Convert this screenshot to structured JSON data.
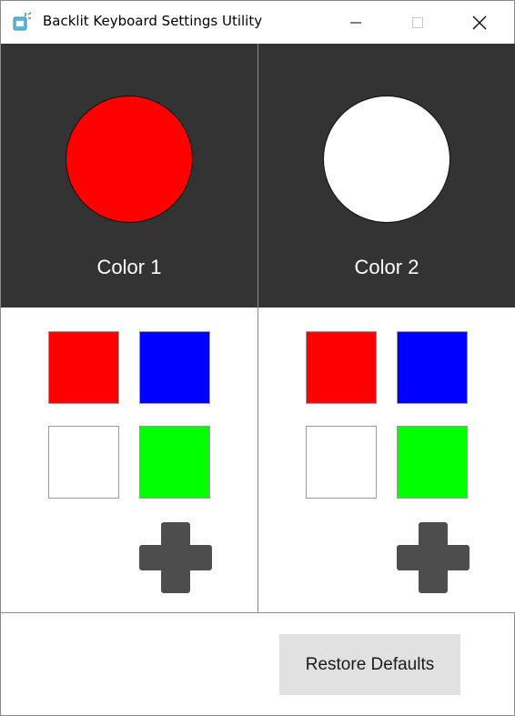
{
  "window": {
    "title": "Backlit Keyboard Settings Utility"
  },
  "panels": [
    {
      "label": "Color 1",
      "selected_color": "#ff0000",
      "swatches": [
        "#ff0000",
        "#0000ff",
        "#ffffff",
        "#00ff00"
      ],
      "add_icon": "plus-icon"
    },
    {
      "label": "Color 2",
      "selected_color": "#ffffff",
      "swatches": [
        "#ff0000",
        "#0000ff",
        "#ffffff",
        "#00ff00"
      ],
      "add_icon": "plus-icon"
    }
  ],
  "footer": {
    "restore_label": "Restore Defaults"
  },
  "colors": {
    "panel_dark": "#333333",
    "button_bg": "#e1e1e1",
    "plus_icon": "#4d4d4d"
  }
}
